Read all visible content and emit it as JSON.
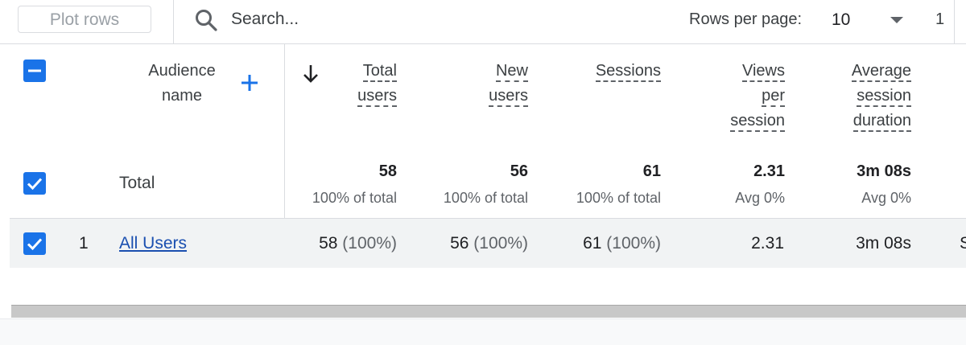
{
  "toolbar": {
    "plot_rows_label": "Plot rows",
    "search_placeholder": "Search...",
    "rows_per_page_label": "Rows per page:",
    "rows_per_page_value": "10",
    "page_indicator_partial": "1"
  },
  "table": {
    "headers": {
      "audience_name_line1": "Audience",
      "audience_name_line2": "name",
      "total_users_line1": "Total",
      "total_users_line2": "users",
      "new_users_line1": "New",
      "new_users_line2": "users",
      "sessions": "Sessions",
      "views_per_session_line1": "Views",
      "views_per_session_line2": "per",
      "views_per_session_line3": "session",
      "avg_session_duration_line1": "Average",
      "avg_session_duration_line2": "session",
      "avg_session_duration_line3": "duration"
    },
    "total": {
      "label": "Total",
      "total_users": "58",
      "total_users_sub": "100% of total",
      "new_users": "56",
      "new_users_sub": "100% of total",
      "sessions": "61",
      "sessions_sub": "100% of total",
      "views_per_session": "2.31",
      "views_per_session_sub": "Avg 0%",
      "avg_session_duration": "3m 08s",
      "avg_session_duration_sub": "Avg 0%"
    },
    "rows": [
      {
        "index": "1",
        "audience_name": "All Users",
        "total_users": "58",
        "total_users_pct": "(100%)",
        "new_users": "56",
        "new_users_pct": "(100%)",
        "sessions": "61",
        "sessions_pct": "(100%)",
        "views_per_session": "2.31",
        "avg_session_duration": "3m 08s",
        "cut_off_char": "S"
      }
    ]
  },
  "colors": {
    "accent": "#1a73e8",
    "link": "#1a4fb0",
    "row_background": "#f1f3f4"
  },
  "icons": {
    "search": "search-icon",
    "add": "plus-icon",
    "sort": "arrow-down-icon",
    "dropdown": "caret-down-icon",
    "checkbox_indeterminate": "minus-checkbox-icon",
    "checkbox_checked": "check-checkbox-icon"
  }
}
